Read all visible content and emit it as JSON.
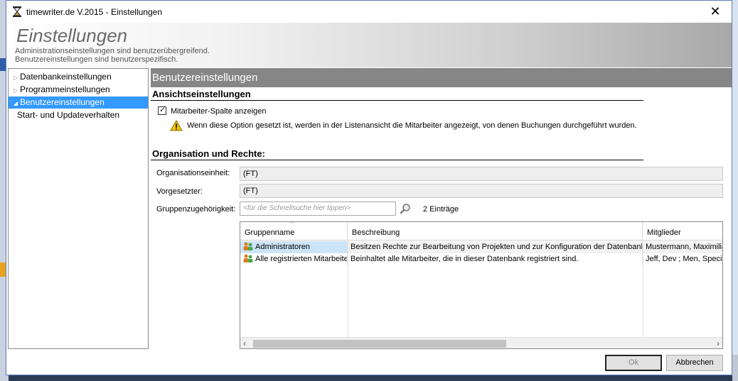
{
  "window": {
    "title": "timewriter.de V.2015 - Einstellungen",
    "close_glyph": "✕"
  },
  "header": {
    "title": "Einstellungen",
    "subtitle_line1": "Administrationseinstellungen sind benutzerübergreifend.",
    "subtitle_line2": "Benutzereinstellungen sind benutzerspezifisch."
  },
  "sidebar": {
    "items": [
      {
        "label": "Datenbankeinstellungen",
        "arrow": "▷"
      },
      {
        "label": "Programmeinstellungen",
        "arrow": "▷"
      },
      {
        "label": "Benutzereinstellungen",
        "arrow": "◢"
      },
      {
        "label": "Start- und Updateverhalten",
        "arrow": ""
      }
    ]
  },
  "content": {
    "section_title": "Benutzereinstellungen",
    "view_settings": {
      "heading": "Ansichtseinstellungen",
      "checkbox_label": "Mitarbeiter-Spalte anzeigen",
      "checkbox_checked": true,
      "warning_text": "Wenn diese Option gesetzt ist, werden in der Listenansicht die Mitarbeiter angezeigt, von denen Buchungen durchgeführt wurden."
    },
    "org": {
      "heading": "Organisation und Rechte:",
      "unit_label": "Organisationseinheit:",
      "unit_value": "(FT)",
      "supervisor_label": "Vorgesetzter:",
      "supervisor_value": "(FT)",
      "groups_label": "Gruppenzugehörigkeit:",
      "search_placeholder": "<für die Schnellsuche hier tippen>",
      "entries_count": "2 Einträge"
    },
    "grid": {
      "columns": [
        "Gruppenname",
        "Beschreibung",
        "Mitglieder"
      ],
      "rows": [
        [
          "Administratoren",
          "Besitzen Rechte zur Bearbeitung von Projekten und zur Konfiguration der Datenbank.",
          "Mustermann, Maximilian"
        ],
        [
          "Alle registrierten Mitarbeiter",
          "Beinhaltet alle Mitarbeiter, die in dieser Datenbank registriert sind.",
          "Jeff, Dev ; Men, Special"
        ]
      ],
      "selected_row": 0
    }
  },
  "buttons": {
    "ok": "Ok",
    "cancel": "Abbrechen"
  },
  "colors": {
    "selection": "#3399ff",
    "section_bar": "#868686",
    "row_selected": "#cce4f7"
  }
}
